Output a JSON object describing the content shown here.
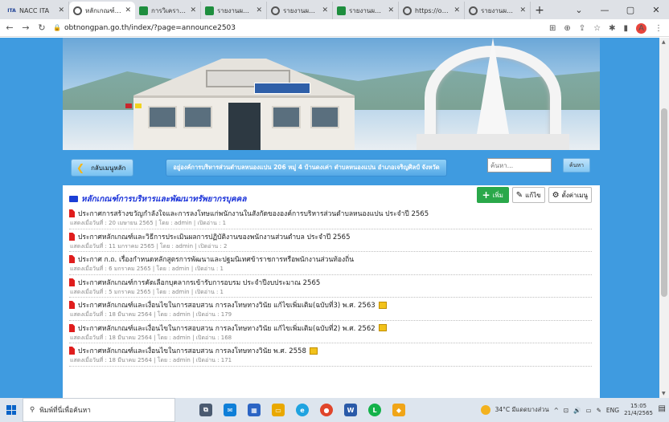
{
  "browser": {
    "tabs": [
      {
        "icon": "nacc-icon",
        "title": "NACC ITA",
        "active": false
      },
      {
        "icon": "chrome-icon",
        "title": "หลักเกณฑ์การ",
        "active": true
      },
      {
        "icon": "sheets-icon",
        "title": "การวิเคราะห์และ",
        "active": false
      },
      {
        "icon": "sheets-icon",
        "title": "รายงานผลการ",
        "active": false
      },
      {
        "icon": "chrome-icon",
        "title": "รายงานผลการ",
        "active": false
      },
      {
        "icon": "sheets-icon",
        "title": "รายงานผลการ",
        "active": false
      },
      {
        "icon": "chrome-icon",
        "title": "https://obtn",
        "active": false
      },
      {
        "icon": "chrome-icon",
        "title": "รายงานผลการ",
        "active": false
      }
    ],
    "url": "obtnongpan.go.th/index/?page=announce2503"
  },
  "site": {
    "back_label": "กลับเมนูหลัก",
    "address": "อยู่องค์การบริหารส่วนตำบลหนองแปน 206 หมู่ 4 บ้านดงเค่า ตำบลหนองแปน อำเภอเจริญศิลป์ จังหวัด",
    "search_placeholder": "ค้นหา...",
    "search_button": "ค้นหา"
  },
  "section": {
    "title": "หลักเกณฑ์การบริหารและพัฒนาทรัพยากรบุคคล",
    "add_label": "เพิ่ม",
    "edit_label": "แก้ไข",
    "settings_label": "ตั้งค่าเมนู"
  },
  "items": [
    {
      "title": "ประกาศการสร้างขวัญกำลังใจและการลงโทษแก่พนักงานในสังกัดขององค์การบริหารส่วนตำบลหนองแปน ประจำปี 2565",
      "meta": "แสดงเมื่อวันที่ : 20 เมษายน 2565 | โดย : admin | เปิดอ่าน : 1",
      "new": false
    },
    {
      "title": "ประกาศหลักเกณฑ์และวิธีการประเมินผลการปฏิบัติงานของพนักงานส่วนตำบล ประจำปี 2565",
      "meta": "แสดงเมื่อวันที่ : 11 มกราคม 2565 | โดย : admin | เปิดอ่าน : 2",
      "new": false
    },
    {
      "title": "ประกาศ ก.ถ. เรื่องกำหนดหลักสูตรการพัฒนาและปฐมนิเทศข้าราชการหรือพนักงานส่วนท้องถิ่น",
      "meta": "แสดงเมื่อวันที่ : 6 มกราคม 2565 | โดย : admin | เปิดอ่าน : 1",
      "new": false
    },
    {
      "title": "ประกาศหลักเกณฑ์การคัดเลือกบุคลากรเข้ารับการอบรม ประจำปีงบประมาณ 2565",
      "meta": "แสดงเมื่อวันที่ : 5 มกราคม 2565 | โดย : admin | เปิดอ่าน : 1",
      "new": false
    },
    {
      "title": "ประกาศหลักเกณฑ์และเงื่อนไขในการสอบสวน การลงโทษทางวินัย แก้ไขเพิ่มเติม(ฉบับที่3) พ.ศ. 2563",
      "meta": "แสดงเมื่อวันที่ : 18 มีนาคม 2564 | โดย : admin | เปิดอ่าน : 179",
      "new": true
    },
    {
      "title": "ประกาศหลักเกณฑ์และเงื่อนไขในการสอบสวน การลงโทษทางวินัย แก้ไขเพิ่มเติม(ฉบับที่2) พ.ศ. 2562",
      "meta": "แสดงเมื่อวันที่ : 18 มีนาคม 2564 | โดย : admin | เปิดอ่าน : 168",
      "new": true
    },
    {
      "title": "ประกาศหลักเกณฑ์และเงื่อนไขในการสอบสวน การลงโทษทางวินัย พ.ศ. 2558",
      "meta": "แสดงเมื่อวันที่ : 18 มีนาคม 2564 | โดย : admin | เปิดอ่าน : 171",
      "new": true
    }
  ],
  "taskbar": {
    "search_placeholder": "พิมพ์ที่นี่เพื่อค้นหา",
    "weather": "34°C มีแดดบางส่วน",
    "lang": "ENG",
    "time": "15:05",
    "date": "21/4/2565"
  },
  "colors": {
    "page_bg": "#3f9be0",
    "section_title": "#1d35d9",
    "add_button": "#2aa84a",
    "doc_icon": "#e01d1d"
  }
}
